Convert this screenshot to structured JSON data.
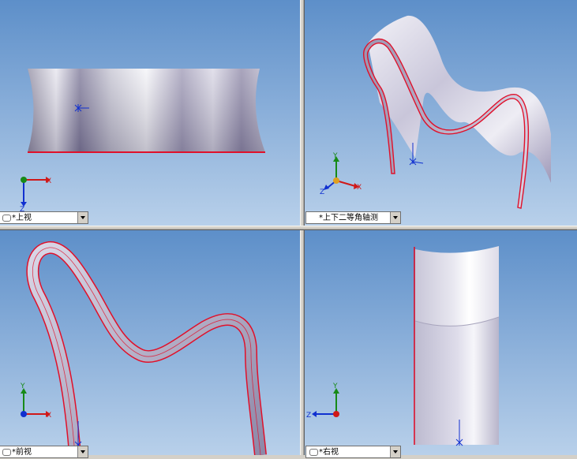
{
  "views": {
    "top": {
      "label": "*上视"
    },
    "isometric": {
      "label": "*上下二等角轴测"
    },
    "front": {
      "label": "*前视"
    },
    "right": {
      "label": "*右视"
    }
  },
  "axes": {
    "x": "X",
    "y": "Y",
    "z": "Z"
  },
  "colors": {
    "edge_highlight": "#e0102a",
    "axis_x": "#d01818",
    "axis_y": "#178a17",
    "axis_z": "#1030d0"
  }
}
